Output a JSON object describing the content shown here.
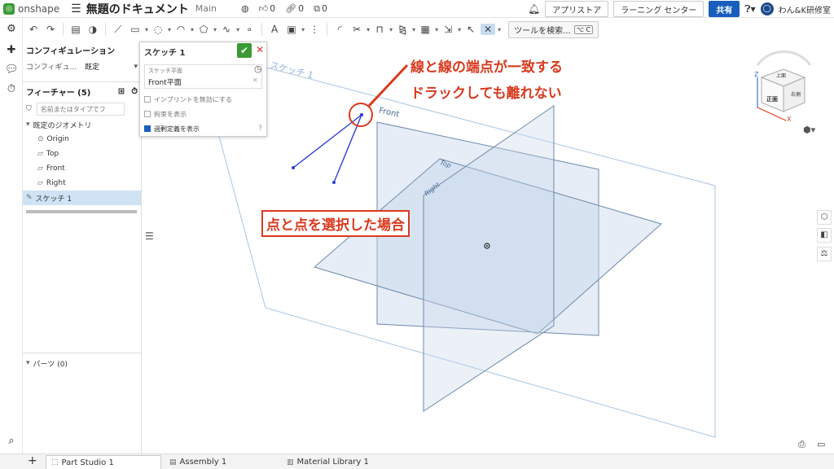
{
  "topbar": {
    "logo_text": "onshape",
    "doc_title": "無題のドキュメント",
    "workspace": "Main",
    "likes": "0",
    "links": "0",
    "copies": "0",
    "appstore_label": "アプリストア",
    "learning_label": "ラーニング センター",
    "share_label": "共有",
    "user_name": "わん&K研修室"
  },
  "toolbar": {
    "search_label": "ツールを検索...",
    "shortcut": "⌥ C"
  },
  "panel": {
    "config_title": "コンフィギュレーション",
    "config_label": "コンフィギュ...",
    "config_value": "既定",
    "features_title": "フィーチャー (5)",
    "filter_placeholder": "名前またはタイプでフ",
    "default_geometry": "既定のジオメトリ",
    "tree": [
      "Origin",
      "Top",
      "Front",
      "Right"
    ],
    "sketch_item": "スケッチ 1",
    "parts_label": "パーツ (0)"
  },
  "sketch_dialog": {
    "title": "スケッチ 1",
    "plane_label": "スケッチ平面",
    "plane_value": "Front平面",
    "check_implicit": "インプリントを無効にする",
    "check_constraints": "拘束を表示",
    "check_overdefined": "過剰定義を表示"
  },
  "viewport": {
    "sketch_label": "スケッチ 1",
    "front_label": "Front",
    "top_label": "Top",
    "right_label": "Right",
    "annotation_1": "線と線の端点が一致する",
    "annotation_2": "ドラックしても離れない",
    "annotation_box": "点と点を選択した場合",
    "cube_top": "上面",
    "cube_front": "正面",
    "cube_right": "右側",
    "axis_z": "Z",
    "axis_x": "X"
  },
  "tabs": [
    "Part Studio 1",
    "Assembly 1",
    "Material Library 1"
  ],
  "colors": {
    "accent": "#1a5ebd",
    "annotation": "#d93a1f",
    "ok": "#3a9a35",
    "plane": "#c8d7ea"
  }
}
